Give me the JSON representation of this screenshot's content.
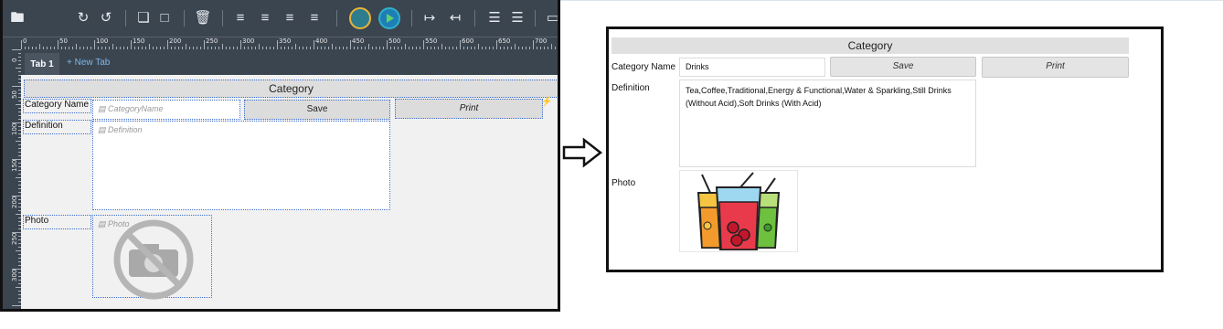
{
  "designer": {
    "toolbar": {
      "icons": [
        "folder-icon",
        "redo-icon",
        "undo-icon",
        "copy-icon",
        "paste-icon",
        "delete-icon",
        "align-left-icon",
        "align-right-icon",
        "align-center-icon",
        "align-justify-icon",
        "save-icon",
        "run-icon",
        "indent-icon",
        "outdent-icon",
        "layers-up-icon",
        "layers-down-icon",
        "eraser-icon"
      ]
    },
    "ruler_h_labels": [
      "0",
      "50",
      "100",
      "150",
      "200",
      "250",
      "300",
      "350",
      "400",
      "450",
      "500",
      "550",
      "600",
      "650",
      "700"
    ],
    "ruler_v_labels": [
      "0",
      "50",
      "100",
      "150",
      "200",
      "250",
      "300"
    ],
    "tabs": {
      "active": "Tab 1",
      "new": "+ New Tab"
    },
    "form": {
      "header": "Category",
      "category_label": "Category Name",
      "category_placeholder": "CategoryName",
      "save": "Save",
      "print": "Print",
      "definition_label": "Definition",
      "definition_placeholder": "Definition",
      "photo_label": "Photo",
      "photo_placeholder": "Photo"
    }
  },
  "preview": {
    "header": "Category",
    "category_label": "Category Name",
    "category_value": "Drinks",
    "save": "Save",
    "print": "Print",
    "definition_label": "Definition",
    "definition_value": "Tea,Coffee,Traditional,Energy & Functional,Water & Sparkling,Still Drinks (Without Acid),Soft Drinks (With Acid)",
    "photo_label": "Photo"
  },
  "colors": {
    "toolbar": "#3b4550",
    "accent_blue": "#3c6fd0",
    "save_circle": "#e8b43a",
    "run_circle": "#1e9bd7"
  }
}
